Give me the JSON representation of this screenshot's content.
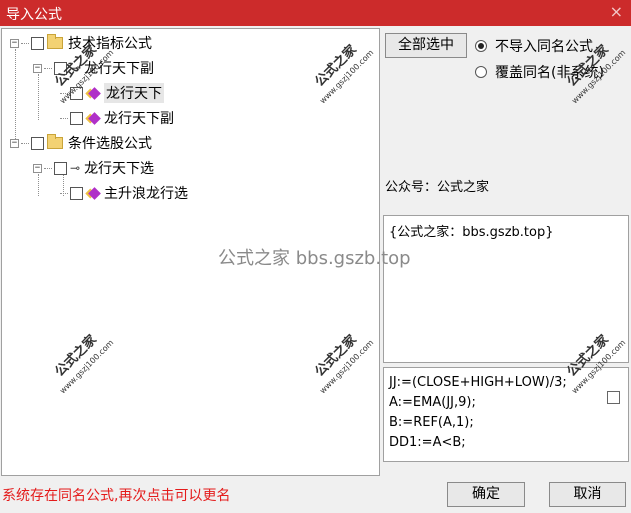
{
  "window": {
    "title": "导入公式",
    "close_glyph": "×"
  },
  "tree": {
    "group1_label": "技术指标公式",
    "group1_item1_label": "龙行天下副",
    "group1_item2_label": "龙行天下",
    "group1_item3_label": "龙行天下副",
    "group2_label": "条件选股公式",
    "group2_item1_label": "龙行天下选",
    "group2_item2_label": "主升浪龙行选"
  },
  "controls": {
    "select_all_label": "全部选中",
    "radio_skip_label": "不导入同名公式",
    "radio_overwrite_label": "覆盖同名(非系统)"
  },
  "info": {
    "wechat_label": "公众号：公式之家",
    "site_text": "{公式之家：bbs.gszb.top}"
  },
  "formula": {
    "text": "JJ:=(CLOSE+HIGH+LOW)/3;\nA:=EMA(JJ,9);\nB:=REF(A,1);\nDD1:=A<B;"
  },
  "footer": {
    "status_text": "系统存在同名公式,再次点击可以更名",
    "ok_label": "确定",
    "cancel_label": "取消"
  },
  "overlay_text": "公式之家 bbs.gszb.top",
  "watermark": {
    "line1": "公式之家",
    "line2": "www.gszj100.com"
  },
  "colors": {
    "titlebar": "#cc2b2b",
    "status_text": "#e41b1b",
    "gem": "#b030c8",
    "folder": "#f3d273"
  },
  "icons": [
    "close-icon",
    "folder-icon",
    "key-icon",
    "gem-icon"
  ]
}
